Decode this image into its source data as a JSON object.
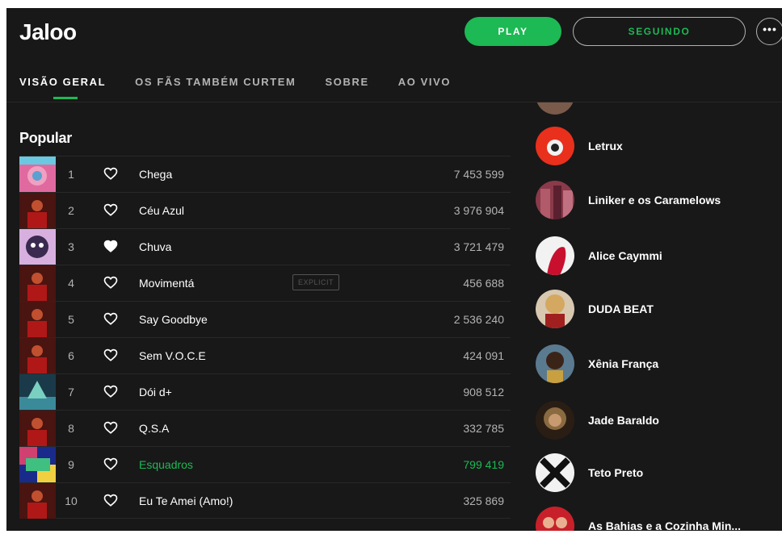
{
  "header": {
    "artist": "Jaloo",
    "play_label": "PLAY",
    "follow_label": "SEGUINDO",
    "more_label": "•••"
  },
  "tabs": [
    {
      "label": "VISÃO GERAL",
      "active": true
    },
    {
      "label": "OS FÃS TAMBÉM CURTEM",
      "active": false
    },
    {
      "label": "SOBRE",
      "active": false
    },
    {
      "label": "AO VIVO",
      "active": false
    }
  ],
  "popular": {
    "title": "Popular",
    "tracks": [
      {
        "num": "1",
        "title": "Chega",
        "plays": "7 453 599",
        "liked": false
      },
      {
        "num": "2",
        "title": "Céu Azul",
        "plays": "3 976 904",
        "liked": false
      },
      {
        "num": "3",
        "title": "Chuva",
        "plays": "3 721 479",
        "liked": true
      },
      {
        "num": "4",
        "title": "Movimentá",
        "plays": "456 688",
        "liked": false,
        "badge": "EXPLICIT"
      },
      {
        "num": "5",
        "title": "Say Goodbye",
        "plays": "2 536 240",
        "liked": false
      },
      {
        "num": "6",
        "title": "Sem V.O.C.E",
        "plays": "424 091",
        "liked": false
      },
      {
        "num": "7",
        "title": "Dói d+",
        "plays": "908 512",
        "liked": false
      },
      {
        "num": "8",
        "title": "Q.S.A",
        "plays": "332 785",
        "liked": false
      },
      {
        "num": "9",
        "title": "Esquadros",
        "plays": "799 419",
        "liked": false,
        "active": true
      },
      {
        "num": "10",
        "title": "Eu Te Amei (Amo!)",
        "plays": "325 869",
        "liked": false
      }
    ]
  },
  "related": [
    {
      "name": "Letrux"
    },
    {
      "name": "Liniker e os Caramelows"
    },
    {
      "name": "Alice Caymmi"
    },
    {
      "name": "DUDA BEAT"
    },
    {
      "name": "Xênia França"
    },
    {
      "name": "Jade Baraldo"
    },
    {
      "name": "Teto Preto"
    },
    {
      "name": "As Bahias e a Cozinha Min..."
    }
  ],
  "colors": {
    "accent": "#1db954",
    "background": "#181818",
    "text_secondary": "#b3b3b3"
  }
}
